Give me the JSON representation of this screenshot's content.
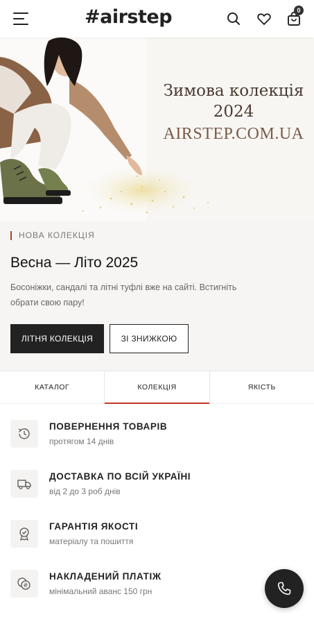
{
  "header": {
    "logo": "#airstep",
    "cart_count": "0",
    "icons": [
      "menu-icon",
      "search-icon",
      "heart-icon",
      "shopping-bag-icon"
    ]
  },
  "banner": {
    "title_line1": "Зимова колекція",
    "title_line2": "2024",
    "url": "AIRSTEP.COM.UA"
  },
  "promo": {
    "kicker": "НОВА КОЛЕКЦІЯ",
    "title": "Весна — Літо 2025",
    "text": "Босоніжки, сандалі та літні туфлі вже на сайті. Встигніть обрати свою пару!",
    "primary_button": "ЛІТНЯ КОЛЕКЦІЯ",
    "secondary_button": "ЗІ ЗНИЖКОЮ"
  },
  "tabs": [
    {
      "label": "КАТАЛОГ",
      "active": false
    },
    {
      "label": "КОЛЕКЦІЯ",
      "active": true
    },
    {
      "label": "ЯКІСТЬ",
      "active": false
    }
  ],
  "features": [
    {
      "title": "ПОВЕРНЕННЯ ТОВАРІВ",
      "subtitle": "протягом 14 днів",
      "icon": "history-icon"
    },
    {
      "title": "ДОСТАВКА ПО ВСІЙ УКРАЇНІ",
      "subtitle": "від 2 до 3 роб днів",
      "icon": "truck-icon"
    },
    {
      "title": "ГАРАНТІЯ ЯКОСТІ",
      "subtitle": "матеріалу та пошиття",
      "icon": "quality-badge-icon"
    },
    {
      "title": "НАКЛАДЕНИЙ ПЛАТІЖ",
      "subtitle": "мінімальний аванс 150 грн",
      "icon": "coins-icon"
    }
  ],
  "colors": {
    "accent": "#c0392b",
    "dark": "#222222",
    "promo_bg": "#f6f5f4"
  }
}
